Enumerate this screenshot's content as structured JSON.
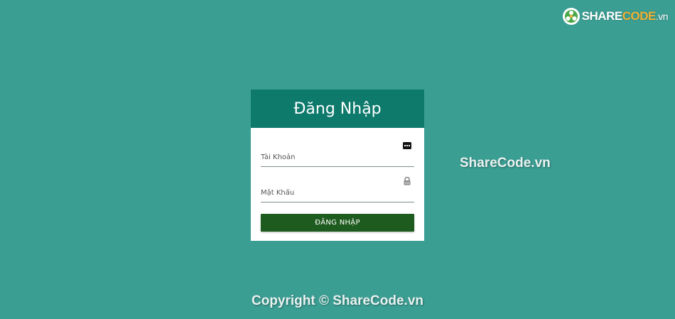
{
  "logo": {
    "brand_main": "SHARE",
    "brand_accent": "CODE",
    "brand_tld": ".vn"
  },
  "watermark": {
    "side_text": "ShareCode.vn",
    "copyright": "Copyright © ShareCode.vn"
  },
  "login": {
    "title": "Đăng Nhập",
    "username_placeholder": "Tài Khoản",
    "password_placeholder": "Mật Khẩu",
    "submit_label": "ĐĂNG NHẬP",
    "username_icon": "id-card-icon",
    "password_icon": "lock-icon"
  },
  "colors": {
    "background": "#3b9e93",
    "header": "#0d7a6c",
    "button": "#1e5b1f",
    "logo_accent": "#f2b233"
  }
}
